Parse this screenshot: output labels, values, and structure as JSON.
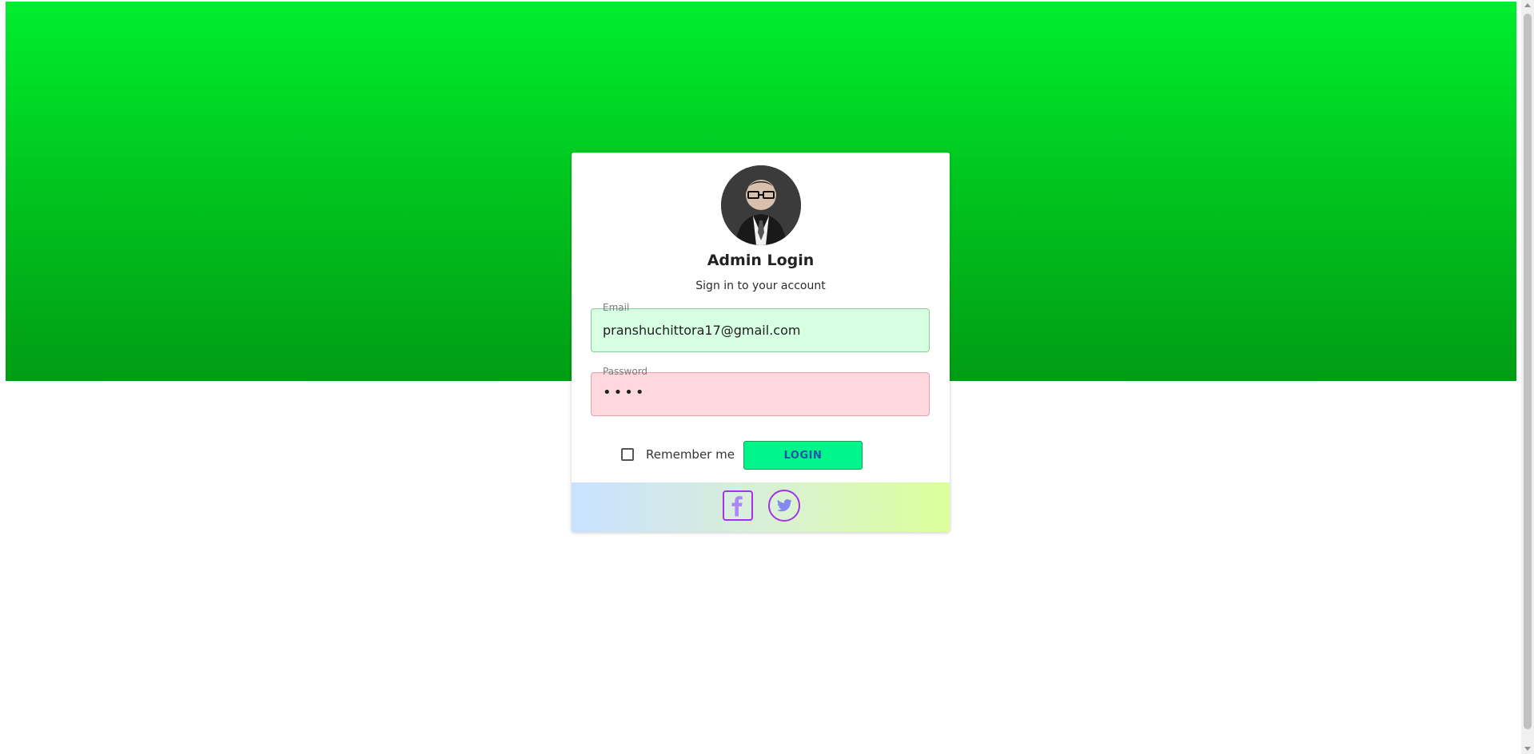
{
  "login": {
    "title": "Admin Login",
    "subtitle": "Sign in to your account",
    "email_label": "Email",
    "email_value": "pranshuchittora17@gmail.com",
    "password_label": "Password",
    "password_value": "••••",
    "remember_label": "Remember me",
    "login_button_label": "LOGIN"
  },
  "social": {
    "facebook_icon": "facebook-icon",
    "twitter_icon": "twitter-icon"
  },
  "colors": {
    "hero_top": "#00ee2e",
    "hero_bottom": "#009d14",
    "email_field_background": "#d7ffe1",
    "password_field_background": "#ffd8dd",
    "login_button_background": "#00f58a",
    "login_button_text": "#2554a7",
    "footer_left": "#c9e1ff",
    "footer_right": "#dcff9a",
    "social_outline": "#a632e8"
  }
}
